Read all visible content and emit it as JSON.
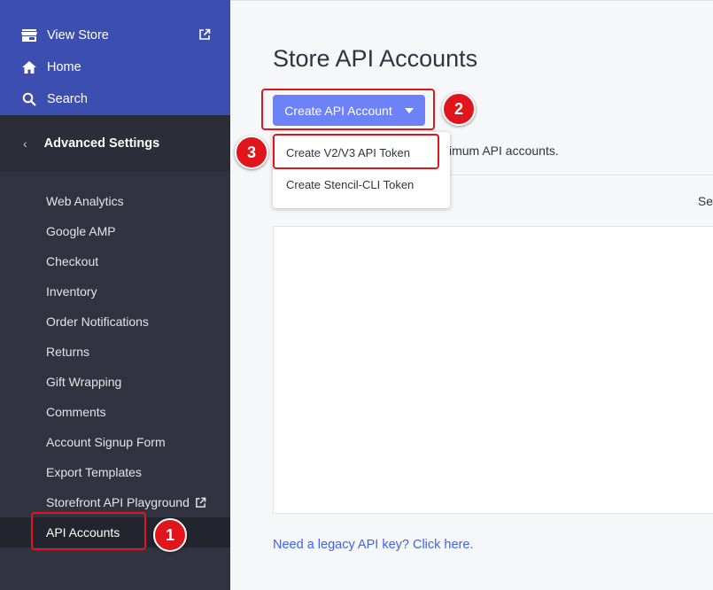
{
  "sidebar": {
    "top_nav": {
      "view_store": "View Store",
      "home": "Home",
      "search": "Search"
    },
    "section": {
      "title": "Advanced Settings"
    },
    "items": [
      {
        "label": "Web Analytics"
      },
      {
        "label": "Google AMP"
      },
      {
        "label": "Checkout"
      },
      {
        "label": "Inventory"
      },
      {
        "label": "Order Notifications"
      },
      {
        "label": "Returns"
      },
      {
        "label": "Gift Wrapping"
      },
      {
        "label": "Comments"
      },
      {
        "label": "Account Signup Form"
      },
      {
        "label": "Export Templates"
      },
      {
        "label": "Storefront API Playground"
      },
      {
        "label": "API Accounts"
      }
    ],
    "active_item": "API Accounts"
  },
  "main": {
    "title": "Store API Accounts",
    "create_button": "Create API Account",
    "info_text": "ximum API accounts.",
    "table_header_partial": "Se",
    "legacy_link": "Need a legacy API key? Click here."
  },
  "dropdown": {
    "items": [
      {
        "label": "Create V2/V3 API Token"
      },
      {
        "label": "Create Stencil-CLI Token"
      }
    ]
  },
  "annotations": {
    "badge_1": "1",
    "badge_2": "2",
    "badge_3": "3"
  },
  "colors": {
    "sidebar_top": "#3c4eb0",
    "sidebar": "#313440",
    "accent_button": "#6d82f6",
    "link": "#3c64f4",
    "highlight": "#e0161c"
  },
  "icons": [
    "storefront-icon",
    "external-link-icon",
    "home-icon",
    "search-icon",
    "chevron-left-icon",
    "caret-down-icon"
  ]
}
